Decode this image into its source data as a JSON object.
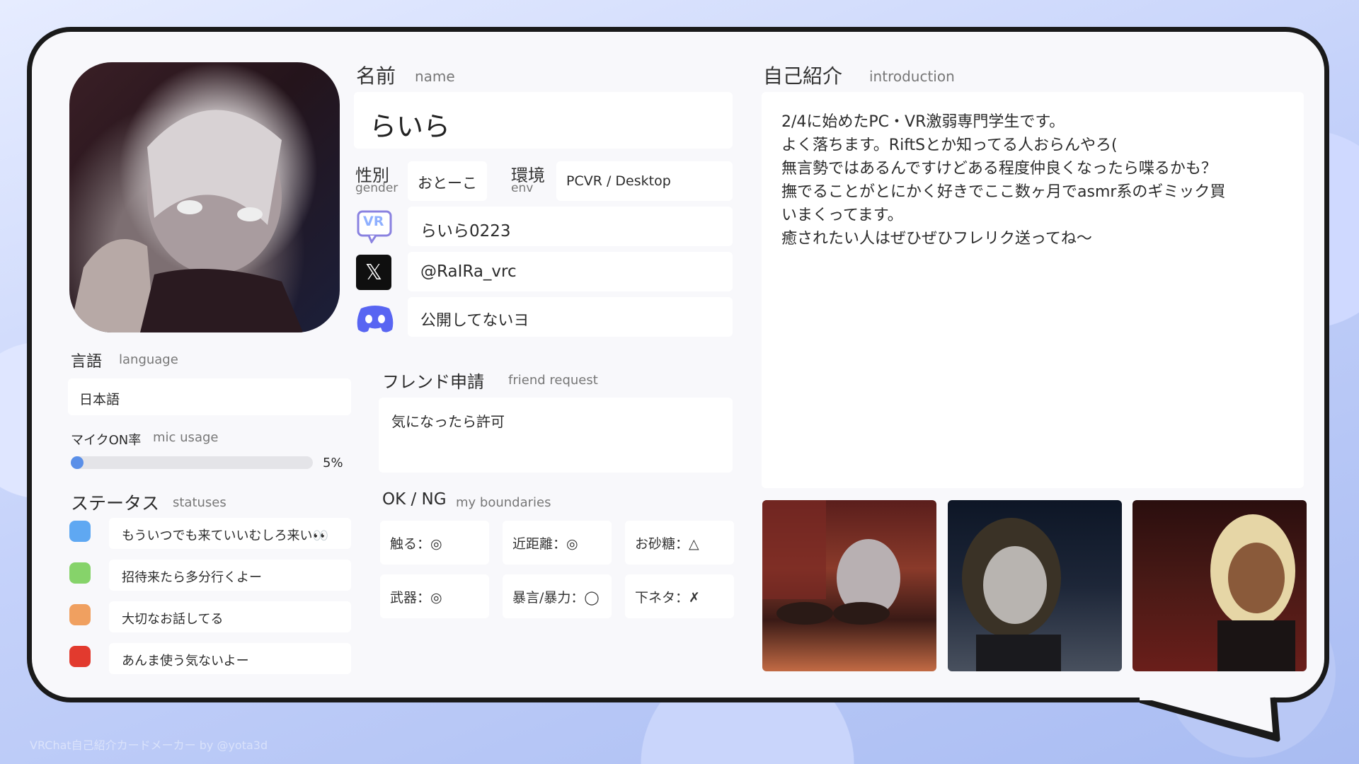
{
  "name": {
    "label_ja": "名前",
    "label_en": "name",
    "value": "らいら"
  },
  "gender": {
    "label_ja": "性別",
    "label_en": "gender",
    "value": "おとーこ"
  },
  "env": {
    "label_ja": "環境",
    "label_en": "env",
    "value": "PCVR / Desktop"
  },
  "accounts": {
    "vrchat_icon": "VR",
    "vrchat": "らいら0223",
    "x_icon": "𝕏",
    "x": "@RaIRa_vrc",
    "discord": "公開してないヨ"
  },
  "language": {
    "label_ja": "言語",
    "label_en": "language",
    "value": "日本語"
  },
  "mic": {
    "label_ja": "マイクON率",
    "label_en": "mic usage",
    "percent_text": "5%",
    "percent": 5
  },
  "statuses": {
    "label_ja": "ステータス",
    "label_en": "statuses",
    "items": [
      {
        "color": "#5fa8f2",
        "text": "もういつでも来ていいむしろ来い👀"
      },
      {
        "color": "#86d36a",
        "text": "招待来たら多分行くよー"
      },
      {
        "color": "#f0a060",
        "text": "大切なお話してる"
      },
      {
        "color": "#e23a2e",
        "text": "あんま使う気ないよー"
      }
    ]
  },
  "friend_request": {
    "label_ja": "フレンド申請",
    "label_en": "friend request",
    "value": "気になったら許可"
  },
  "boundaries": {
    "label_ja": "OK / NG",
    "label_en": "my boundaries",
    "items": [
      "触る：◎",
      "近距離：◎",
      "お砂糖：△",
      "武器：◎",
      "暴言/暴力：◯",
      "下ネタ：✗"
    ]
  },
  "introduction": {
    "label_ja": "自己紹介",
    "label_en": "introduction",
    "lines": [
      "2/4に始めたPC・VR激弱専門学生です。",
      "よく落ちます。RiftSとか知ってる人おらんやろ(",
      "無言勢ではあるんですけどある程度仲良くなったら喋るかも？",
      "撫でることがとにかく好きでここ数ヶ月でasmr系のギミック買",
      "いまくってます。",
      "癒されたい人はぜひぜひフレリク送ってね〜"
    ]
  },
  "footer": "VRChat自己紹介カードメーカー by @yota3d"
}
